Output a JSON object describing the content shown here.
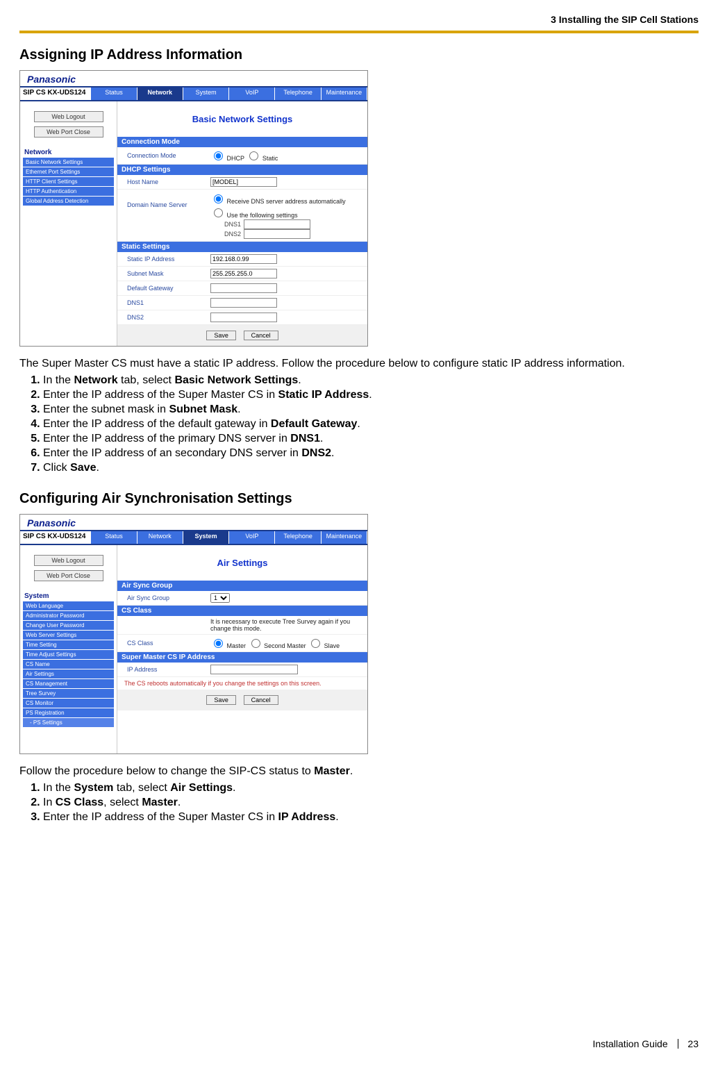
{
  "header": {
    "chapter": "3 Installing the SIP Cell Stations"
  },
  "section1": {
    "title": "Assigning IP Address Information",
    "intro": "The Super Master CS must have a static IP address. Follow the procedure below to configure static IP address information.",
    "steps": [
      {
        "pre": "In the ",
        "b1": "Network",
        "mid1": " tab, select ",
        "b2": "Basic Network Settings",
        "post": "."
      },
      {
        "pre": "Enter the IP address of the Super Master CS in ",
        "b1": "Static IP Address",
        "post": "."
      },
      {
        "pre": "Enter the subnet mask in ",
        "b1": "Subnet Mask",
        "post": "."
      },
      {
        "pre": "Enter the IP address of the default gateway in ",
        "b1": "Default Gateway",
        "post": "."
      },
      {
        "pre": "Enter the IP address of the primary DNS server in ",
        "b1": "DNS1",
        "post": "."
      },
      {
        "pre": "Enter the IP address of an secondary DNS server in ",
        "b1": "DNS2",
        "post": "."
      },
      {
        "pre": "Click ",
        "b1": "Save",
        "post": "."
      }
    ]
  },
  "shot1": {
    "brand": "Panasonic",
    "model": "SIP CS KX-UDS124",
    "tabs": [
      "Status",
      "Network",
      "System",
      "VoIP",
      "Telephone",
      "Maintenance"
    ],
    "tab_active": 1,
    "left_buttons": [
      "Web Logout",
      "Web Port Close"
    ],
    "side_title": "Network",
    "side_items": [
      "Basic Network Settings",
      "Ethernet Port Settings",
      "HTTP Client Settings",
      "HTTP Authentication",
      "Global Address Detection"
    ],
    "panel_title": "Basic Network Settings",
    "sec_conn": "Connection Mode",
    "row_conn": {
      "label": "Connection Mode",
      "opt1": "DHCP",
      "opt2": "Static"
    },
    "sec_dhcp": "DHCP Settings",
    "row_host": {
      "label": "Host Name",
      "value": "[MODEL]"
    },
    "row_dns": {
      "label": "Domain Name Server",
      "opt1": "Receive DNS server address automatically",
      "opt2": "Use the following settings",
      "dns1_label": "DNS1",
      "dns2_label": "DNS2",
      "dns1_value": "",
      "dns2_value": ""
    },
    "sec_static": "Static Settings",
    "rows_static": [
      {
        "label": "Static IP Address",
        "value": "192.168.0.99"
      },
      {
        "label": "Subnet Mask",
        "value": "255.255.255.0"
      },
      {
        "label": "Default Gateway",
        "value": ""
      },
      {
        "label": "DNS1",
        "value": ""
      },
      {
        "label": "DNS2",
        "value": ""
      }
    ],
    "btn_save": "Save",
    "btn_cancel": "Cancel"
  },
  "section2": {
    "title": "Configuring Air Synchronisation Settings",
    "intro_pre": "Follow the procedure below to change the SIP-CS status to ",
    "intro_b": "Master",
    "intro_post": ".",
    "steps": [
      {
        "pre": "In the ",
        "b1": "System",
        "mid1": " tab, select ",
        "b2": "Air Settings",
        "post": "."
      },
      {
        "pre": "In ",
        "b1": "CS Class",
        "mid1": ", select ",
        "b2": "Master",
        "post": "."
      },
      {
        "pre": "Enter the IP address of the Super Master CS in ",
        "b1": "IP Address",
        "post": "."
      }
    ]
  },
  "shot2": {
    "brand": "Panasonic",
    "model": "SIP CS KX-UDS124",
    "tabs": [
      "Status",
      "Network",
      "System",
      "VoIP",
      "Telephone",
      "Maintenance"
    ],
    "tab_active": 2,
    "left_buttons": [
      "Web Logout",
      "Web Port Close"
    ],
    "side_title": "System",
    "side_items": [
      "Web Language",
      "Administrator Password",
      "Change User Password",
      "Web Server Settings",
      "Time Setting",
      "Time Adjust Settings",
      "CS Name",
      "Air Settings",
      "CS Management",
      "Tree Survey",
      "CS Monitor",
      "PS Registration"
    ],
    "side_sub": "- PS Settings",
    "panel_title": "Air Settings",
    "sec_air": "Air Sync Group",
    "row_air": {
      "label": "Air Sync Group",
      "value": "1"
    },
    "sec_class": "CS Class",
    "class_note": "It is necessary to execute Tree Survey again if you change this mode.",
    "row_class": {
      "label": "CS Class",
      "opt1": "Master",
      "opt2": "Second Master",
      "opt3": "Slave"
    },
    "sec_ip": "Super Master CS IP Address",
    "row_ip": {
      "label": "IP Address",
      "value": ""
    },
    "warn": "The CS reboots automatically if you change the settings on this screen.",
    "btn_save": "Save",
    "btn_cancel": "Cancel"
  },
  "footer": {
    "doc": "Installation Guide",
    "page": "23"
  }
}
